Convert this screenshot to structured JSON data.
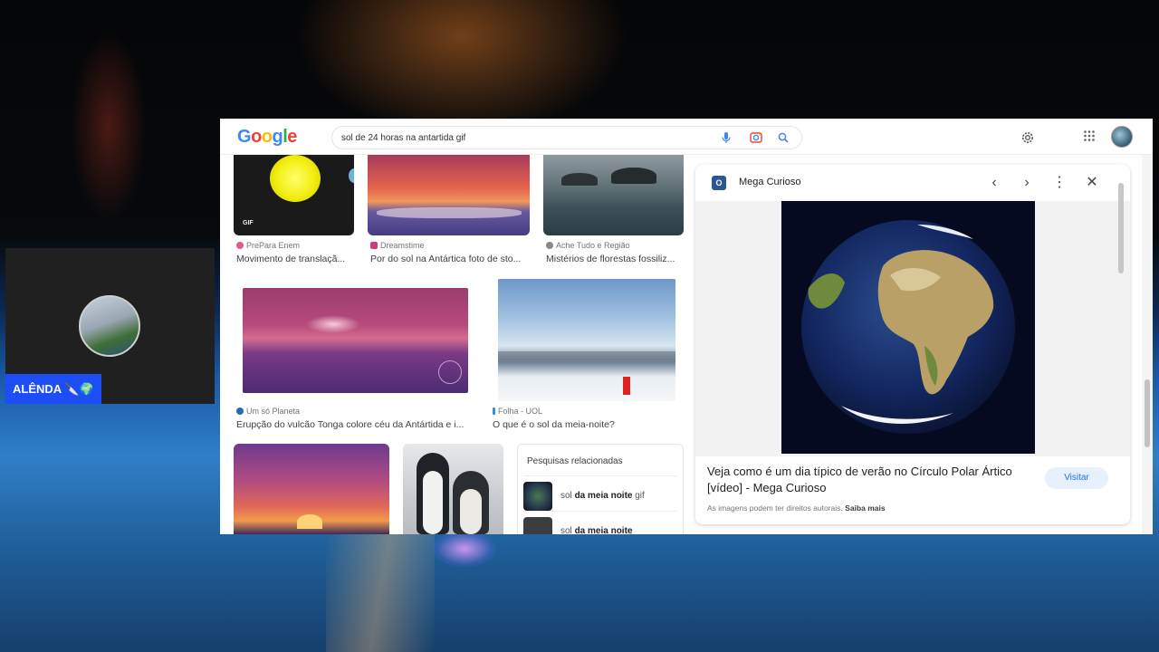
{
  "search": {
    "query": "sol de 24 horas na antartida gif"
  },
  "results": [
    {
      "source": "PrePara Enem",
      "title": "Movimento de translaçã...",
      "badge": "GIF"
    },
    {
      "source": "Dreamstime",
      "title": "Por do sol na Antártica foto de sto..."
    },
    {
      "source": "Ache Tudo e Região",
      "title": "Mistérios de florestas fossiliz..."
    },
    {
      "source": "Um só Planeta",
      "title": "Erupção do vulcão Tonga colore céu da Antártida e i..."
    },
    {
      "source": "Folha - UOL",
      "title": "O que é o sol da meia-noite?"
    }
  ],
  "related": {
    "title": "Pesquisas relacionadas",
    "items": [
      {
        "prefix": "sol ",
        "bold": "da meia noite",
        "suffix": " gif"
      },
      {
        "prefix": "sol ",
        "bold": "da meia noite",
        "suffix": ""
      }
    ]
  },
  "panel": {
    "favicon": "O",
    "site": "Mega Curioso",
    "title": "Veja como é um dia típico de verão no Círculo Polar Ártico [vídeo] - Mega Curioso",
    "visit_label": "Visitar",
    "rights_text": "As imagens podem ter direitos autorais.",
    "learn_more": "Saiba mais"
  },
  "icons": [
    "mic-icon",
    "lens-icon",
    "search-icon",
    "gear-icon",
    "apps-icon",
    "chevron-left-icon",
    "chevron-right-icon",
    "more-vert-icon",
    "close-icon"
  ],
  "webcam": {
    "name": "ALÊNDA 🔪🌍"
  },
  "colors": {
    "accent": "#1a73e8",
    "name_tag": "#1d4ef5"
  }
}
